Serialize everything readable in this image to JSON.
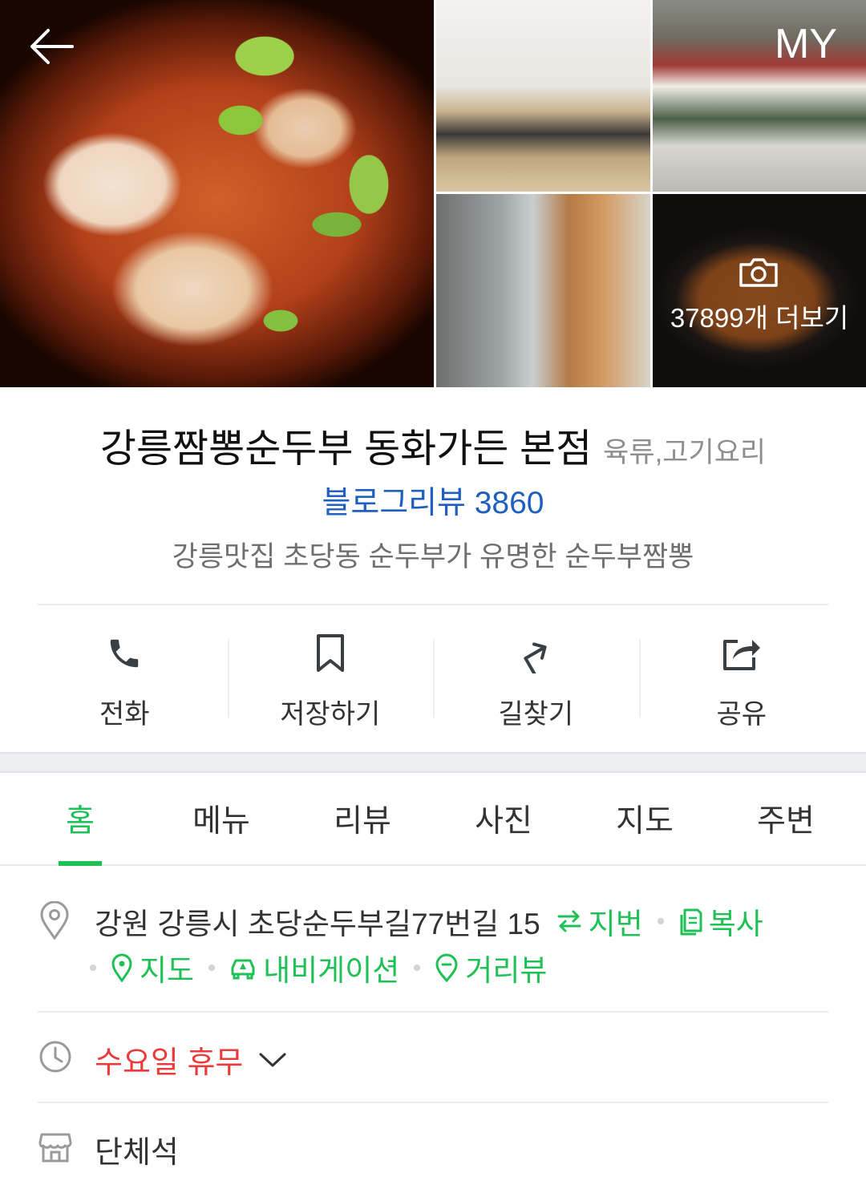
{
  "header": {
    "my_label": "MY",
    "photos_more_label": "37899개 더보기"
  },
  "place": {
    "name": "강릉짬뽕순두부 동화가든 본점",
    "category": "육류,고기요리",
    "blog_review": "블로그리뷰 3860",
    "description": "강릉맛집 초당동 순두부가 유명한 순두부짬뽕"
  },
  "actions": [
    {
      "label": "전화",
      "icon": "phone-icon"
    },
    {
      "label": "저장하기",
      "icon": "bookmark-icon"
    },
    {
      "label": "길찾기",
      "icon": "directions-icon"
    },
    {
      "label": "공유",
      "icon": "share-icon"
    }
  ],
  "tabs": [
    "홈",
    "메뉴",
    "리뷰",
    "사진",
    "지도",
    "주변"
  ],
  "active_tab": "홈",
  "address": {
    "text": "강원 강릉시 초당순두부길77번길 15",
    "jibun_label": "지번",
    "copy_label": "복사",
    "map_label": "지도",
    "navigation_label": "내비게이션",
    "streetview_label": "거리뷰"
  },
  "hours": {
    "status": "수요일 휴무"
  },
  "facilities": {
    "label": "단체석"
  },
  "colors": {
    "accent_green": "#1fc157",
    "link_blue": "#1e5fbf",
    "closed_red": "#ea3b3b"
  }
}
